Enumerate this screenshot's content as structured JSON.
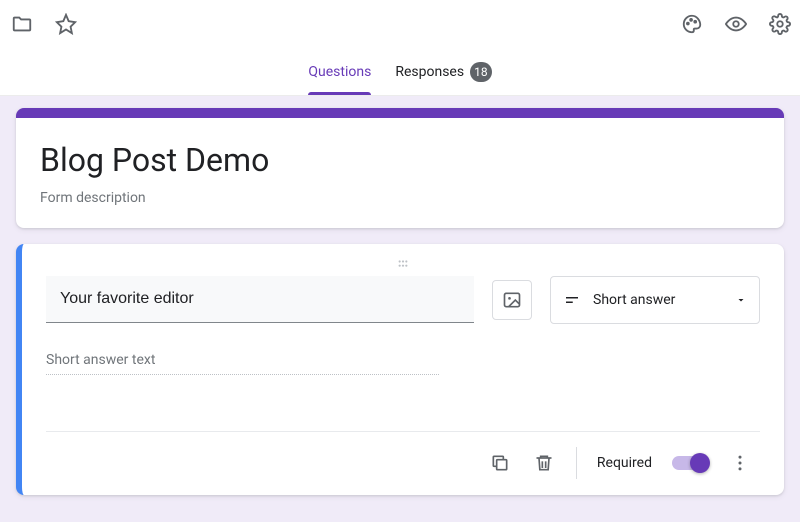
{
  "toolbar": {
    "icons": {
      "folder": "folder",
      "star": "star",
      "palette": "palette",
      "preview": "eye",
      "settings": "gear"
    }
  },
  "tabs": {
    "questions": "Questions",
    "responses": "Responses",
    "responses_count": "18"
  },
  "form": {
    "title": "Blog Post Demo",
    "description": "Form description"
  },
  "question": {
    "text": "Your favorite editor",
    "answer_placeholder": "Short answer text",
    "type_label": "Short answer",
    "required_label": "Required",
    "required_on": true
  },
  "colors": {
    "accent": "#673ab7",
    "active_border": "#4285f4",
    "canvas_bg": "#f0ebf8"
  }
}
